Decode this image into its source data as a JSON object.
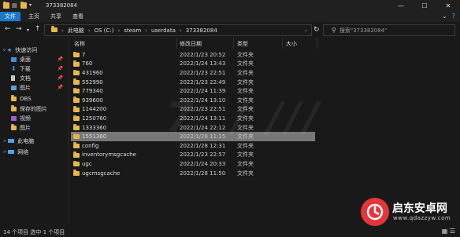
{
  "window": {
    "title": "373382084",
    "minimize": "—",
    "maximize": "☐",
    "close": "✕"
  },
  "ribbon": {
    "tabs": [
      "文件",
      "主页",
      "共享",
      "查看"
    ]
  },
  "address": {
    "path": [
      "此电脑",
      "OS (C:)",
      "steam",
      "userdata",
      "373382084"
    ],
    "search_placeholder": "搜索\"373382084\""
  },
  "nav": {
    "items": [
      {
        "label": "快速访问",
        "icon": "star-icon",
        "color": "#4aa3f0",
        "pinned": false
      },
      {
        "label": "桌面",
        "icon": "desktop-icon",
        "color": "#3d8fe0",
        "pinned": true
      },
      {
        "label": "下载",
        "icon": "download-icon",
        "color": "#3d8fe0",
        "pinned": true
      },
      {
        "label": "文档",
        "icon": "document-icon",
        "color": "#c9c9c9",
        "pinned": true
      },
      {
        "label": "图片",
        "icon": "picture-icon",
        "color": "#5aa0d8",
        "pinned": true
      },
      {
        "label": "OBS",
        "icon": "folder-icon",
        "color": "#e8b64c",
        "pinned": false
      },
      {
        "label": "保存的图片",
        "icon": "folder-icon",
        "color": "#e8b64c",
        "pinned": false
      },
      {
        "label": "视频",
        "icon": "video-icon",
        "color": "#9a5fd0",
        "pinned": false
      },
      {
        "label": "图片",
        "icon": "folder-icon",
        "color": "#e8b64c",
        "pinned": false
      },
      {
        "label": "此电脑",
        "icon": "computer-icon",
        "color": "#4aa3f0",
        "pinned": false
      },
      {
        "label": "网络",
        "icon": "network-icon",
        "color": "#4aa3f0",
        "pinned": false
      }
    ]
  },
  "columns": {
    "name": "名称",
    "date": "修改日期",
    "type": "类型",
    "size": "大小"
  },
  "files": [
    {
      "name": "7",
      "date": "2022/1/23 20:52",
      "type": "文件夹"
    },
    {
      "name": "760",
      "date": "2022/1/24 13:43",
      "type": "文件夹"
    },
    {
      "name": "431960",
      "date": "2022/1/23 22:51",
      "type": "文件夹"
    },
    {
      "name": "552990",
      "date": "2022/1/23 22:49",
      "type": "文件夹"
    },
    {
      "name": "779340",
      "date": "2022/1/24 11:39",
      "type": "文件夹"
    },
    {
      "name": "939600",
      "date": "2022/1/24 13:10",
      "type": "文件夹"
    },
    {
      "name": "1144200",
      "date": "2022/1/23 22:51",
      "type": "文件夹"
    },
    {
      "name": "1250760",
      "date": "2022/1/24 13:11",
      "type": "文件夹"
    },
    {
      "name": "1333360",
      "date": "2022/1/24 22:12",
      "type": "文件夹"
    },
    {
      "name": "1551360",
      "date": "2022/1/28 11:15",
      "type": "文件夹",
      "selected": true
    },
    {
      "name": "config",
      "date": "2022/1/28 12:31",
      "type": "文件夹"
    },
    {
      "name": "inventorymsgcache",
      "date": "2022/1/23 22:57",
      "type": "文件夹"
    },
    {
      "name": "ugc",
      "date": "2022/1/24 20:33",
      "type": "文件夹"
    },
    {
      "name": "ugcmsgcache",
      "date": "2022/1/28 11:50",
      "type": "文件夹"
    }
  ],
  "status": {
    "text": "14 个项目   选中 1 个项目"
  },
  "watermark": {
    "logo_text": "启东安卓网",
    "logo_sub": "www.qdazzyw.com"
  }
}
